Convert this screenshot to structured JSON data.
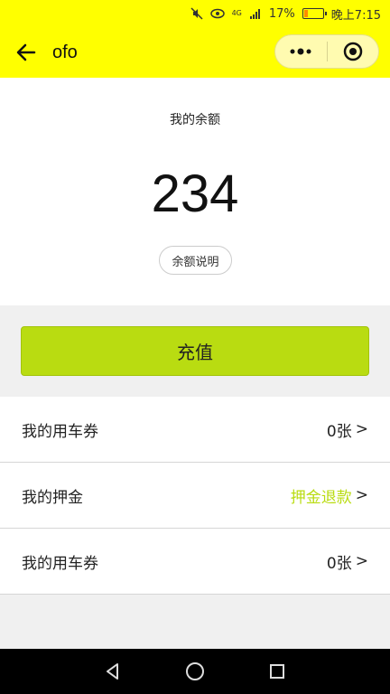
{
  "status_bar": {
    "battery_percent": "17%",
    "battery_level": 0.17,
    "time": "晚上7:15",
    "network": "4G",
    "icons": [
      "mute-icon",
      "eye-icon",
      "network-4g-icon",
      "signal-icon",
      "battery-icon"
    ]
  },
  "nav": {
    "title": "ofo",
    "back_icon": "arrow-left-icon",
    "capsule_icons": [
      "more-dots-icon",
      "close-circle-icon"
    ]
  },
  "balance": {
    "label": "我的余额",
    "value": "234",
    "explain_button": "余额说明"
  },
  "recharge_button": "充值",
  "list": [
    {
      "label": "我的用车券",
      "value": "0张",
      "arrow": ">"
    },
    {
      "label": "我的押金",
      "value": "押金退款",
      "arrow": ">"
    },
    {
      "label": "我的用车券",
      "value": "0张",
      "arrow": ">"
    }
  ],
  "colors": {
    "bar": "#ffff00",
    "accent": "#b9dc11"
  },
  "android_nav_icons": [
    "back-triangle-icon",
    "home-circle-icon",
    "recents-square-icon"
  ]
}
